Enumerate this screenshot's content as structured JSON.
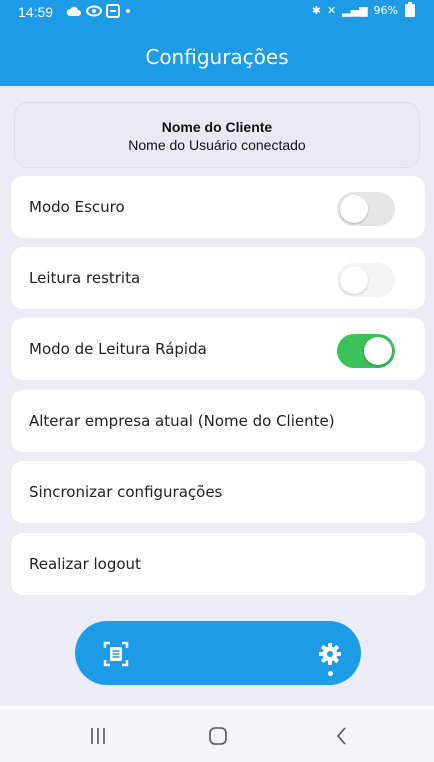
{
  "status_bar": {
    "time": "14:59",
    "right_text": "96%"
  },
  "header": {
    "title": "Configurações"
  },
  "client_card": {
    "client_name": "Nome do Cliente",
    "user_name": "Nome do Usuário conectado"
  },
  "settings": [
    {
      "label": "Modo Escuro",
      "toggle": true,
      "on": false
    },
    {
      "label": "Leitura restrita",
      "toggle": true,
      "on": false
    },
    {
      "label": "Modo de Leitura Rápida",
      "toggle": true,
      "on": true
    },
    {
      "label": "Alterar empresa atual (Nome do Cliente)",
      "toggle": false
    },
    {
      "label": "Sincronizar configurações",
      "toggle": false
    },
    {
      "label": "Realizar logout",
      "toggle": false
    }
  ],
  "bottom_nav": {
    "items": [
      "scan-document-icon",
      "gear-icon"
    ],
    "active": "gear-icon"
  },
  "colors": {
    "primary": "#1e9be6",
    "toggle_on": "#3ac15a",
    "background": "#ececf7"
  }
}
